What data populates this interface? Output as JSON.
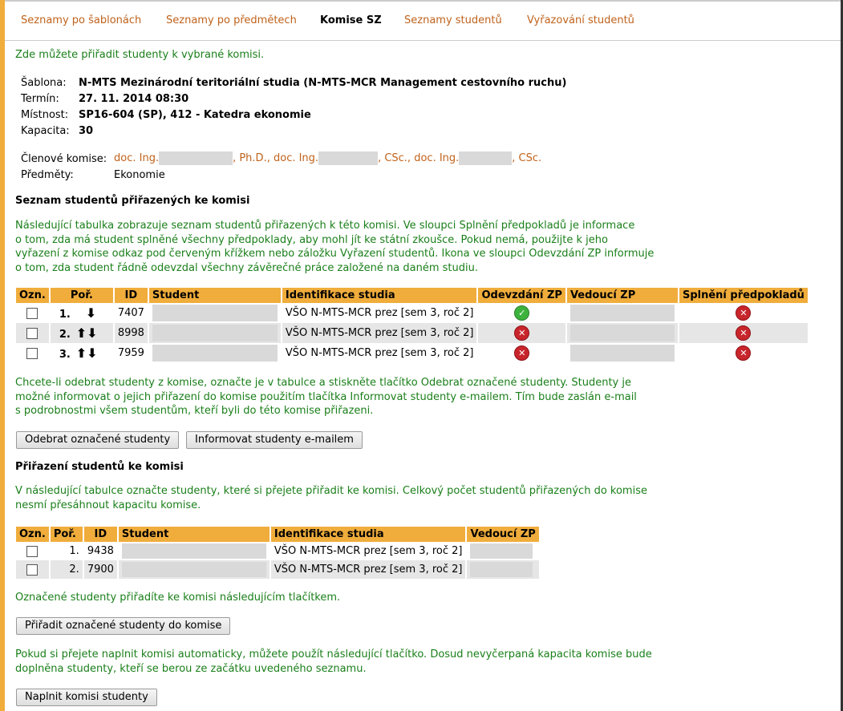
{
  "nav": {
    "tabs": [
      {
        "label": "Seznamy po šablonách"
      },
      {
        "label": "Seznamy po předmětech"
      },
      {
        "label": "Komise SZ"
      },
      {
        "label": "Seznamy studentů"
      },
      {
        "label": "Vyřazování studentů"
      }
    ]
  },
  "intro": "Zde můžete přiřadit studenty k vybrané komisi.",
  "info": {
    "sablona_label": "Šablona:",
    "sablona_value": "N-MTS Mezinárodní teritoriální studia (N-MTS-MCR Management cestovního ruchu)",
    "termin_label": "Termín:",
    "termin_value": "27. 11. 2014 08:30",
    "mistnost_label": "Místnost:",
    "mistnost_value": "SP16-604 (SP), 412 - Katedra ekonomie",
    "kapacita_label": "Kapacita:",
    "kapacita_value": "30",
    "clenove_label": "Členové komise:",
    "clen1_prefix": "doc. Ing.",
    "clen1_suffix": ", Ph.D.,",
    "clen2_prefix": "doc. Ing.",
    "clen2_suffix": ", CSc.,",
    "clen3_prefix": "doc. Ing.",
    "clen3_suffix": ", CSc.",
    "predmety_label": "Předměty:",
    "predmety_value": "Ekonomie"
  },
  "assigned": {
    "title": "Seznam studentů přiřazených ke komisi",
    "desc_lines": [
      "Následující tabulka zobrazuje seznam studentů přiřazených k této komisi. Ve sloupci Splnění předpokladů je informace",
      "o tom, zda má student splněné všechny předpoklady, aby mohl jít ke státní zkoušce. Pokud nemá, použijte k jeho",
      "vyřazení z komise odkaz pod červeným křížkem nebo záložku Vyřazení studentů. Ikona ve sloupci Odevzdání ZP informuje",
      "o tom, zda student řádně odevzdal všechny závěrečné práce založené na daném studiu."
    ],
    "headers": [
      "Ozn.",
      "Poř.",
      "ID",
      "Student",
      "Identifikace studia",
      "Odevzdání ZP",
      "Vedoucí ZP",
      "Splnění předpokladů"
    ],
    "rows": [
      {
        "order": "1.",
        "id": "7407",
        "study": "VŠO N-MTS-MCR prez [sem 3, roč 2]",
        "zp_ok": true,
        "prereq_ok": false
      },
      {
        "order": "2.",
        "id": "8998",
        "study": "VŠO N-MTS-MCR prez [sem 3, roč 2]",
        "zp_ok": false,
        "prereq_ok": false
      },
      {
        "order": "3.",
        "id": "7959",
        "study": "VŠO N-MTS-MCR prez [sem 3, roč 2]",
        "zp_ok": false,
        "prereq_ok": false
      }
    ],
    "remove_desc_lines": [
      "Chcete-li odebrat studenty z komise, označte je v tabulce a stiskněte tlačítko Odebrat označené studenty. Studenty je",
      "možné informovat o jejich přiřazení do komise použitím tlačítka Informovat studenty e-mailem. Tím bude zaslán e-mail",
      "s podrobnostmi všem studentům, kteří byli do této komise přiřazeni."
    ],
    "remove_button": "Odebrat označené studenty",
    "inform_button": "Informovat studenty e-mailem"
  },
  "assign": {
    "title": "Přiřazení studentů ke komisi",
    "desc_lines": [
      "V následující tabulce označte studenty, které si přejete přiřadit ke komisi. Celkový počet studentů přiřazených do komise",
      "nesmí přesáhnout kapacitu komise."
    ],
    "headers": [
      "Ozn.",
      "Poř.",
      "ID",
      "Student",
      "Identifikace studia",
      "Vedoucí ZP"
    ],
    "rows": [
      {
        "order": "1.",
        "id": "9438",
        "study": "VŠO N-MTS-MCR prez [sem 3, roč 2]"
      },
      {
        "order": "2.",
        "id": "7900",
        "study": "VŠO N-MTS-MCR prez [sem 3, roč 2]"
      }
    ],
    "assign_desc": "Označené studenty přiřadíte ke komisi následujícím tlačítkem.",
    "assign_button": "Přiřadit označené studenty do komise",
    "fill_desc_lines": [
      "Pokud si přejete naplnit komisi automaticky, můžete použít následující tlačítko. Dosud nevyčerpaná kapacita komise bude",
      "doplněna studenty, kteří se berou ze začátku uvedeného seznamu."
    ],
    "fill_button": "Naplnit komisi studenty"
  }
}
